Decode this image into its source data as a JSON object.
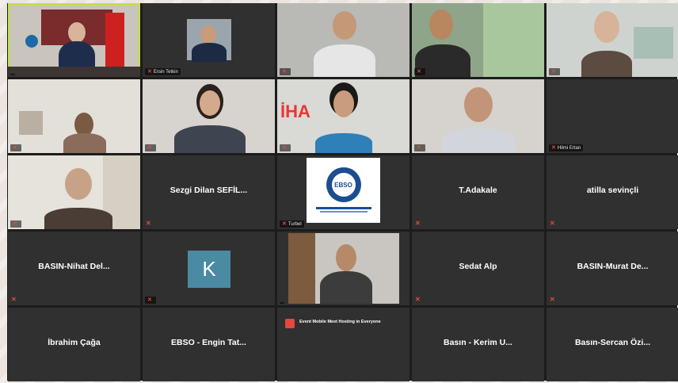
{
  "meeting": {
    "tiles": [
      {
        "type": "video",
        "name": "",
        "speaker": true,
        "muted": false
      },
      {
        "type": "video",
        "name": "Ersin Tetkin",
        "muted": true
      },
      {
        "type": "video",
        "name": "",
        "muted": true
      },
      {
        "type": "video",
        "name": "",
        "muted": true
      },
      {
        "type": "video",
        "name": "",
        "muted": true
      },
      {
        "type": "video",
        "name": "",
        "muted": true
      },
      {
        "type": "video",
        "name": "",
        "muted": true
      },
      {
        "type": "video",
        "name": "",
        "muted": true
      },
      {
        "type": "video",
        "name": "",
        "muted": true
      },
      {
        "type": "empty",
        "name": "Hilmi Ertan",
        "muted": true
      },
      {
        "type": "video",
        "name": "",
        "muted": true
      },
      {
        "type": "name",
        "name": "Sezgi Dilan SEFİL...",
        "muted": true
      },
      {
        "type": "logo",
        "name": "Turbel",
        "logo_text": "EBSO",
        "muted": true
      },
      {
        "type": "name",
        "name": "T.Adakale",
        "muted": true
      },
      {
        "type": "name",
        "name": "atilla sevinçli",
        "muted": true
      },
      {
        "type": "name",
        "name": "BASIN-Nihat Del...",
        "muted": true
      },
      {
        "type": "avatar",
        "name": "",
        "avatar_letter": "K",
        "muted": true
      },
      {
        "type": "video",
        "name": "",
        "muted": false
      },
      {
        "type": "name",
        "name": "Sedat Alp",
        "muted": true
      },
      {
        "type": "name",
        "name": "BASIN-Murat De...",
        "muted": true
      },
      {
        "type": "name",
        "name": "İbrahim Çağa",
        "muted": false
      },
      {
        "type": "name",
        "name": "EBSO - Engin Tat...",
        "muted": false
      },
      {
        "type": "notification",
        "notif_title": "Event Mobile Meet Hosting in Everyone",
        "notif_text": "",
        "muted": false
      },
      {
        "type": "name",
        "name": "Basın - Kerim U...",
        "muted": false
      },
      {
        "type": "name",
        "name": "Basın-Sercan Özi...",
        "muted": false
      }
    ]
  },
  "colors": {
    "speaker_highlight": "#c3e33a",
    "muted_icon": "#e8473d",
    "tile_bg": "#303030",
    "avatar_bg": "#4b8aa3",
    "logo_blue": "#1b4d8f"
  },
  "icons": {
    "muted": "mic-muted-icon"
  }
}
